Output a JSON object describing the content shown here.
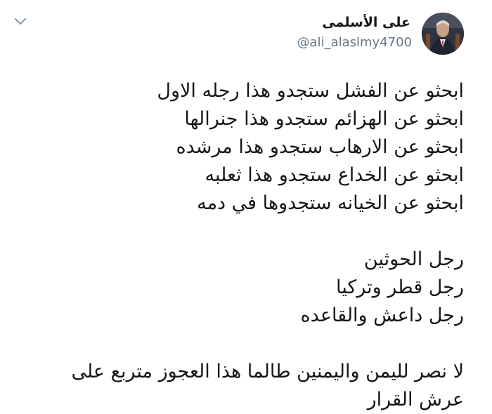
{
  "tweet": {
    "author": {
      "display_name": "على الأسلمى",
      "handle": "@ali_alaslmy4700",
      "avatar_icon": "profile-photo"
    },
    "menu_icon": "chevron-down-icon",
    "body": {
      "stanza1": [
        "ابحثو عن الفشل ستجدو هذا رجله الاول",
        "ابحثو عن الهزائم ستجدو هذا جنرالها",
        "ابحثو عن الارهاب ستجدو هذا مرشده",
        "ابحثو عن الخداع ستجدو هذا ثعلبه",
        "ابحثو عن الخيانه ستجدوها في دمه"
      ],
      "stanza2": [
        "رجل الحوثين",
        "رجل قطر وتركيا",
        "رجل داعش والقاعده"
      ],
      "closing": "لا نصر لليمن واليمنين طالما هذا العجوز متربع على عرش القرار"
    }
  }
}
